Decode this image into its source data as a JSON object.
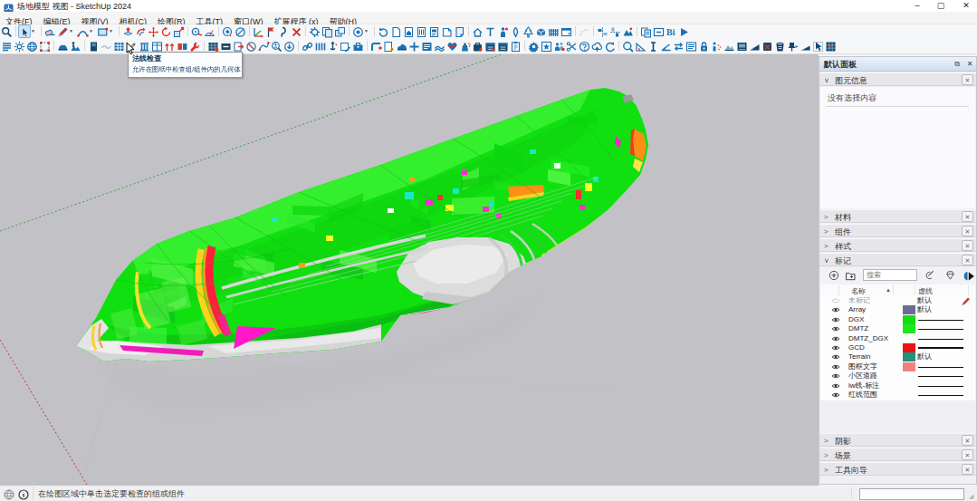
{
  "window": {
    "title": "场地模型 视图 - SketchUp 2024",
    "minimize_label": "最小化",
    "maximize_label": "最大化",
    "close_label": "关闭"
  },
  "menu": {
    "items": [
      "文件(F)",
      "编辑(E)",
      "视图(V)",
      "相机(C)",
      "绘图(R)",
      "工具(T)",
      "窗口(W)",
      "扩展程序 (x)",
      "帮助(H)"
    ]
  },
  "toolbars": {
    "row1": [
      {
        "t": "ico",
        "i": "zoom",
        "n": "zoom-tool"
      },
      {
        "t": "sep"
      },
      {
        "t": "ico",
        "i": "select",
        "n": "select-tool",
        "pressed": true
      },
      {
        "t": "drop"
      },
      {
        "t": "sep"
      },
      {
        "t": "ico",
        "i": "eraser",
        "n": "eraser-tool"
      },
      {
        "t": "ico",
        "i": "pencil",
        "n": "line-tool"
      },
      {
        "t": "drop"
      },
      {
        "t": "ico",
        "i": "arc",
        "n": "arc-tool"
      },
      {
        "t": "drop"
      },
      {
        "t": "ico",
        "i": "rect",
        "n": "rectangle-tool"
      },
      {
        "t": "drop"
      },
      {
        "t": "sep"
      },
      {
        "t": "ico",
        "i": "pushpull",
        "n": "push-pull-tool"
      },
      {
        "t": "ico",
        "i": "offset",
        "n": "offset-tool"
      },
      {
        "t": "ico",
        "i": "move",
        "n": "move-tool"
      },
      {
        "t": "ico",
        "i": "rotate",
        "n": "rotate-tool"
      },
      {
        "t": "ico",
        "i": "scale",
        "n": "scale-tool"
      },
      {
        "t": "sep"
      },
      {
        "t": "ico",
        "i": "tape",
        "n": "tape-measure-tool"
      },
      {
        "t": "ico",
        "i": "protractor",
        "n": "protractor-tool"
      },
      {
        "t": "sep"
      },
      {
        "t": "ico",
        "i": "paint",
        "n": "paint-bucket-tool"
      },
      {
        "t": "ico",
        "i": "hideo",
        "n": "hide-rest-tool"
      },
      {
        "t": "sep"
      },
      {
        "t": "ico",
        "i": "axes",
        "n": "axes-tool"
      },
      {
        "t": "ico",
        "i": "flag",
        "n": "position-tool"
      },
      {
        "t": "ico",
        "i": "query",
        "n": "query-tool"
      },
      {
        "t": "ico",
        "i": "delx",
        "n": "delete-tool"
      },
      {
        "t": "sep"
      },
      {
        "t": "ico",
        "i": "compgear",
        "n": "make-component"
      },
      {
        "t": "ico",
        "i": "copysheets",
        "n": "copy-tool"
      },
      {
        "t": "ico",
        "i": "groupstack",
        "n": "group-tool"
      },
      {
        "t": "sep"
      },
      {
        "t": "ico",
        "i": "stylecircle",
        "n": "style-tool"
      },
      {
        "t": "drop"
      },
      {
        "t": "sep"
      },
      {
        "t": "ico",
        "i": "viewrestore",
        "n": "previous-view"
      },
      {
        "t": "ico",
        "i": "docblank",
        "n": "new-document"
      },
      {
        "t": "ico",
        "i": "dochouse",
        "n": "open-template"
      },
      {
        "t": "ico",
        "i": "doccol",
        "n": "document-columns"
      },
      {
        "t": "ico",
        "i": "docmark",
        "n": "document-save"
      },
      {
        "t": "ico",
        "i": "docfold",
        "n": "document-copy"
      },
      {
        "t": "ico",
        "i": "doccorner",
        "n": "document-paste"
      },
      {
        "t": "sep"
      },
      {
        "t": "ico",
        "i": "home",
        "n": "home-view"
      },
      {
        "t": "ico",
        "i": "textT",
        "n": "text-tool"
      },
      {
        "t": "ico",
        "i": "person",
        "n": "component-person"
      },
      {
        "t": "ico",
        "i": "leaf",
        "n": "leaf-tool"
      },
      {
        "t": "ico",
        "i": "tree",
        "n": "tree-tool"
      },
      {
        "t": "ico",
        "i": "box3d",
        "n": "3d-box-tool"
      },
      {
        "t": "ico",
        "i": "fence",
        "n": "fence-tool"
      },
      {
        "t": "ico",
        "i": "windrop",
        "n": "window-presets"
      },
      {
        "t": "sep"
      },
      {
        "t": "ico",
        "i": "ghost2",
        "n": "hidden-geometry"
      },
      {
        "t": "sep"
      },
      {
        "t": "ico",
        "i": "align1",
        "n": "align-tool"
      },
      {
        "t": "ico",
        "i": "align2",
        "n": "distribute-tool"
      },
      {
        "t": "ico",
        "i": "mountain",
        "n": "terrain-tool"
      },
      {
        "t": "sep"
      },
      {
        "t": "ico",
        "i": "sheets2",
        "n": "pages-tool"
      },
      {
        "t": "ico",
        "i": "minusbox",
        "n": "collapse-tool"
      },
      {
        "t": "ico",
        "i": "bitext",
        "n": "bim-info-tool"
      },
      {
        "t": "ico",
        "i": "play",
        "n": "run-animation"
      }
    ],
    "row2": [
      {
        "t": "ico",
        "i": "layers",
        "n": "layers-list"
      },
      {
        "t": "ico",
        "i": "sun",
        "n": "shadows-toggle"
      },
      {
        "t": "ico",
        "i": "globe",
        "n": "geo-location"
      },
      {
        "t": "ico",
        "i": "selbox",
        "n": "zoom-selection"
      },
      {
        "t": "sep"
      },
      {
        "t": "ico",
        "i": "helmet",
        "n": "walk-tool"
      },
      {
        "t": "ico",
        "i": "mtperson",
        "n": "position-camera"
      },
      {
        "t": "sep"
      },
      {
        "t": "ico",
        "i": "darkblock",
        "n": "section-display"
      },
      {
        "t": "ico",
        "i": "wavefaint",
        "n": "soften-edges"
      },
      {
        "t": "ico",
        "i": "tableblue",
        "n": "grid-table-tool"
      },
      {
        "t": "ico",
        "i": "pencilcur",
        "n": "inspect-tool",
        "hover": true
      },
      {
        "t": "ico",
        "i": "columns",
        "n": "column-tool"
      },
      {
        "t": "ico",
        "i": "windowgrid",
        "n": "window-maker"
      },
      {
        "t": "ico",
        "i": "redpair",
        "n": "red-arrows-tool"
      },
      {
        "t": "ico",
        "i": "redblue",
        "n": "flip-tool"
      },
      {
        "t": "ico",
        "i": "wrench",
        "n": "fix-tool"
      },
      {
        "t": "sep"
      },
      {
        "t": "ico",
        "i": "gridred",
        "n": "mesh-tool"
      },
      {
        "t": "ico",
        "i": "blockminus",
        "n": "subtract-tool"
      },
      {
        "t": "ico",
        "i": "exportred",
        "n": "export-tool"
      },
      {
        "t": "ico",
        "i": "purge",
        "n": "purge-tool"
      },
      {
        "t": "ico",
        "i": "curvered",
        "n": "bezier-tool"
      },
      {
        "t": "ico",
        "i": "findperson",
        "n": "find-component"
      },
      {
        "t": "ico",
        "i": "downcircle",
        "n": "download-tool"
      },
      {
        "t": "sep"
      },
      {
        "t": "ico",
        "i": "link",
        "n": "link-tool"
      },
      {
        "t": "ico",
        "i": "fence3",
        "n": "array-tool"
      },
      {
        "t": "ico",
        "i": "anchor",
        "n": "drop-tool"
      },
      {
        "t": "ico",
        "i": "winpencil",
        "n": "edit-window"
      },
      {
        "t": "ico",
        "i": "toolbox",
        "n": "toolbox"
      },
      {
        "t": "sep"
      },
      {
        "t": "ico",
        "i": "pipeplus",
        "n": "pipe-add-tool"
      },
      {
        "t": "ico",
        "i": "docwarn",
        "n": "check-document"
      },
      {
        "t": "ico",
        "i": "shoe",
        "n": "follow-tool"
      },
      {
        "t": "ico",
        "i": "crossblue",
        "n": "move-snap-tool"
      },
      {
        "t": "ico",
        "i": "listlines",
        "n": "list-tool"
      },
      {
        "t": "ico",
        "i": "terrainwave",
        "n": "sandbox-tool"
      },
      {
        "t": "ico",
        "i": "heart",
        "n": "solid-inspector"
      },
      {
        "t": "ico",
        "i": "spray",
        "n": "spray-tool"
      },
      {
        "t": "ico",
        "i": "bagdark",
        "n": "material-bag"
      },
      {
        "t": "ico",
        "i": "caldarkred",
        "n": "schedule-tool"
      },
      {
        "t": "ico",
        "i": "caldark",
        "n": "calendar-tool"
      },
      {
        "t": "ico",
        "i": "clipboard",
        "n": "clipboard-tool"
      },
      {
        "t": "sep"
      },
      {
        "t": "ico",
        "i": "gear",
        "n": "settings-tool"
      },
      {
        "t": "ico",
        "i": "starbox",
        "n": "effects-tool"
      },
      {
        "t": "ico",
        "i": "people",
        "n": "people-tool"
      },
      {
        "t": "ico",
        "i": "scissor",
        "n": "cut-tool"
      },
      {
        "t": "ico",
        "i": "helpq",
        "n": "help-tool"
      },
      {
        "t": "ico",
        "i": "cloudup",
        "n": "upload-tool"
      },
      {
        "t": "ico",
        "i": "refresh",
        "n": "refresh-tool"
      },
      {
        "t": "sep"
      },
      {
        "t": "ico",
        "i": "magbig",
        "n": "zoom-big-tool"
      },
      {
        "t": "ico",
        "i": "anglered",
        "n": "angle-tool"
      },
      {
        "t": "ico",
        "i": "ibeam",
        "n": "beam-tool"
      },
      {
        "t": "ico",
        "i": "slope",
        "n": "slope-tool"
      },
      {
        "t": "ico",
        "i": "swap",
        "n": "swap-tool"
      },
      {
        "t": "ico",
        "i": "menulines",
        "n": "menu-list-tool"
      },
      {
        "t": "ico",
        "i": "lock",
        "n": "lock-tool"
      },
      {
        "t": "ico",
        "i": "antperson",
        "n": "scatter-tool"
      },
      {
        "t": "ico",
        "i": "terraingrey",
        "n": "terrain-grey-tool"
      },
      {
        "t": "ico",
        "i": "windark",
        "n": "dark-window-tool"
      },
      {
        "t": "ico",
        "i": "wedge",
        "n": "ramp-tool"
      },
      {
        "t": "ico",
        "i": "stamp",
        "n": "stamp-tool"
      },
      {
        "t": "ico",
        "i": "bucket",
        "n": "bucket-tool"
      },
      {
        "t": "ico",
        "i": "pushpin",
        "n": "pin-tool"
      },
      {
        "t": "ico",
        "i": "wedge2",
        "n": "grade-tool"
      },
      {
        "t": "ico",
        "i": "mousedark",
        "n": "pointer-settings"
      },
      {
        "t": "ico",
        "i": "texgrid",
        "n": "texture-tool"
      }
    ]
  },
  "tooltip": {
    "title": "法线检查",
    "desc": "允许在图纸中检查组/组件内的几何体"
  },
  "viewport": {
    "background": "#c2c2c6",
    "axis_green": "#3f9b3f",
    "axis_red": "#b9413a",
    "model_green": "#17e317"
  },
  "panel": {
    "title": "默认面板",
    "entity_info": {
      "label": "图元信息",
      "empty_text": "没有选择内容"
    },
    "sections_top": [
      "材料",
      "组件",
      "样式"
    ],
    "tags": {
      "label": "标记",
      "add_tag_label": "添加标记",
      "add_folder_label": "添加标记文件夹",
      "search_placeholder": "搜索",
      "columns": {
        "name": "名称",
        "dashes": "虚线"
      },
      "default_dash_label": "默认",
      "rows": [
        {
          "name": "未标记",
          "eye": "hollow",
          "swatch": null,
          "dash": "默认",
          "current": true,
          "muted": true
        },
        {
          "name": "Array",
          "eye": "solid",
          "swatch": "#6b6b94",
          "dash": "默认"
        },
        {
          "name": "DGX",
          "eye": "solid",
          "swatch": "#14dd14",
          "dash": "line"
        },
        {
          "name": "DMTZ",
          "eye": "solid",
          "swatch": "#1de81d",
          "dash": "line"
        },
        {
          "name": "DMTZ_DGX",
          "eye": "solid",
          "swatch": null,
          "dash": "line"
        },
        {
          "name": "GCD",
          "eye": "solid",
          "swatch": "#ee1111",
          "dash": "thick"
        },
        {
          "name": "Terrain",
          "eye": "solid",
          "swatch": "#219180",
          "dash": "默认"
        },
        {
          "name": "图框文字",
          "eye": "solid",
          "swatch": "#f28080",
          "dash": "line"
        },
        {
          "name": "小区道路",
          "eye": "solid",
          "swatch": null,
          "dash": "line"
        },
        {
          "name": "lw线-标注",
          "eye": "solid",
          "swatch": null,
          "dash": "line"
        },
        {
          "name": "红线范围",
          "eye": "solid",
          "swatch": null,
          "dash": "line"
        }
      ]
    },
    "sections_bottom": [
      "阴影",
      "场景",
      "工具向导"
    ]
  },
  "status": {
    "text": "在绘图区域中单击选定要检查的组或组件",
    "measurements_value": ""
  }
}
